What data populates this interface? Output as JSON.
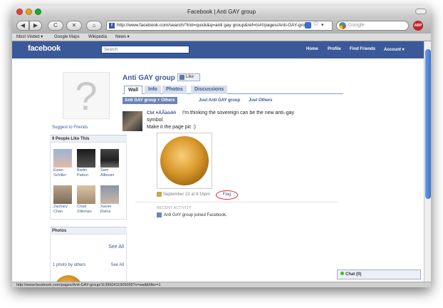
{
  "browser": {
    "window_title": "Facebook | Anti GAY group",
    "url": "http://www.facebook.com/search/?init=quick&q=anti gay group&ref=ts#!/pages/Anti-GAY-group",
    "search_placeholder": "Google",
    "back_glyph": "◀",
    "forward_glyph": "▶",
    "reload_glyph": "C",
    "stop_glyph": "✕",
    "home_glyph": "⌂",
    "star_glyph": "☆",
    "chevron_glyph": "▾",
    "favicon_letter": "f",
    "abp_label": "ABP",
    "bookmarks": [
      "Most Visited ▾",
      "Google Maps",
      "Wikipedia",
      "News ▾"
    ],
    "status_url": "http://www.facebook.com/pages/Anti-GAY-group/113950411905095?v=wall&filter=1"
  },
  "facebook": {
    "logo": "facebook",
    "search_placeholder": "Search",
    "nav": {
      "home": "Home",
      "profile": "Profile",
      "find_friends": "Find Friends",
      "account": "Account ▾"
    }
  },
  "page": {
    "title": "Anti GAY group",
    "like_button": "Like",
    "profile_placeholder_glyph": "?",
    "suggest_link": "Suggest to Friends",
    "tabs": [
      "Wall",
      "Info",
      "Photos",
      "Discussions"
    ],
    "filters": [
      "Anti GAY group + Others",
      "Just Anti GAY group",
      "Just Others"
    ]
  },
  "people_box": {
    "title": "9 People Like This",
    "likers": [
      {
        "name": "Ewan",
        "name2": "Schiller"
      },
      {
        "name": "Bartin",
        "name2": "Patton"
      },
      {
        "name": "Sam",
        "name2": "Allbusin"
      },
      {
        "name": "Zachary",
        "name2": "Chan"
      },
      {
        "name": "Chad",
        "name2": "Zilleman"
      },
      {
        "name": "Xavier",
        "name2": "Rams"
      }
    ]
  },
  "photos_box": {
    "title": "Photos",
    "see_all": "See All",
    "by_others": "1 photo by others",
    "by_others_see_all": "See All"
  },
  "post": {
    "author": "Cbt ¤ÁÃäòðñ",
    "text_line1": "I'm thinking the sovereign can be the new anti–gay",
    "text_line2": "symbol.",
    "text_line3": "Make it the page pic :)",
    "timestamp": "September 22 at 8:16pm",
    "flag_link": "Flag"
  },
  "activity": {
    "header": "RECENT ACTIVITY",
    "item": "Anti GAY group joined Facebook."
  },
  "chat": {
    "label": "Chat (0)"
  }
}
